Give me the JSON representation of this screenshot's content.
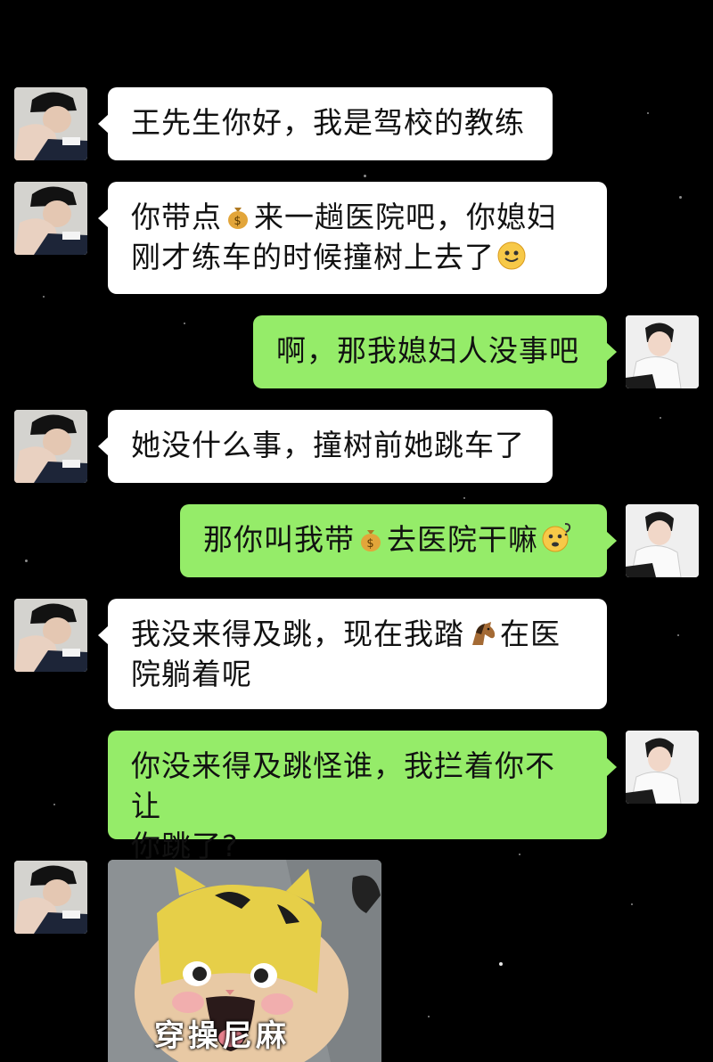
{
  "chat": {
    "messages": [
      {
        "side": "left",
        "parts": [
          "王先生你好，我是驾校的教练"
        ]
      },
      {
        "side": "left",
        "parts": [
          "你带点",
          "来一趟医院吧，你媳妇",
          "刚才练车的时候撞树上去了"
        ],
        "icons": [
          "money-bag-icon",
          "smile-emoji-icon"
        ]
      },
      {
        "side": "right",
        "parts": [
          "啊，那我媳妇人没事吧"
        ]
      },
      {
        "side": "left",
        "parts": [
          "她没什么事，撞树前她跳车了"
        ]
      },
      {
        "side": "right",
        "parts": [
          "那你叫我带",
          "去医院干嘛"
        ],
        "icons": [
          "money-bag-icon",
          "confused-emoji-icon"
        ]
      },
      {
        "side": "left",
        "parts": [
          "我没来得及跳，现在我踏",
          "在医",
          "院躺着呢"
        ],
        "icons": [
          "horse-emoji-icon"
        ]
      },
      {
        "side": "right",
        "parts": [
          "你没来得及跳怪谁，我拦着你不让",
          "你跳了?"
        ]
      },
      {
        "side": "left",
        "type": "sticker",
        "caption": "穿操尼麻"
      }
    ]
  }
}
